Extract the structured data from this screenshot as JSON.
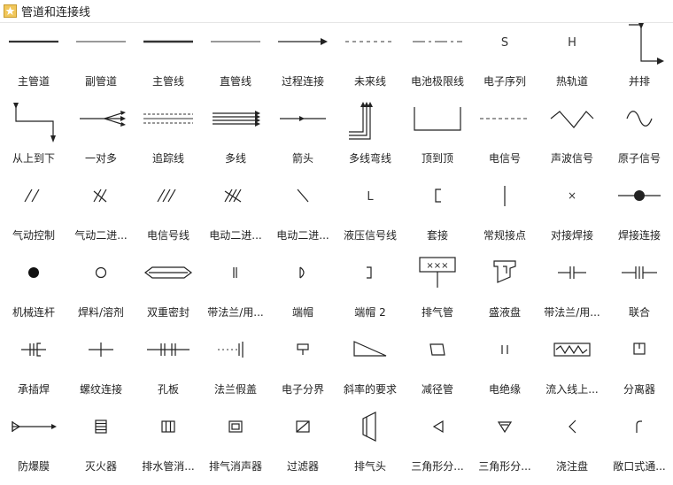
{
  "header": {
    "title": "管道和连接线"
  },
  "rows": [
    [
      {
        "id": "main-pipe",
        "label": "主管道"
      },
      {
        "id": "secondary-pipe",
        "label": "副管道"
      },
      {
        "id": "main-line",
        "label": "主管线"
      },
      {
        "id": "straight-line",
        "label": "直管线"
      },
      {
        "id": "process-connection",
        "label": "过程连接"
      },
      {
        "id": "future-line",
        "label": "未来线"
      },
      {
        "id": "battery-limit-line",
        "label": "电池极限线"
      },
      {
        "id": "electronic-sequence",
        "label": "电子序列",
        "glyph": "S"
      },
      {
        "id": "hot-rail",
        "label": "热轨道",
        "glyph": "H"
      },
      {
        "id": "parallel-arrange",
        "label": "并排"
      }
    ],
    [
      {
        "id": "top-to-bottom",
        "label": "从上到下"
      },
      {
        "id": "one-to-many",
        "label": "一对多"
      },
      {
        "id": "tracing-line",
        "label": "追踪线"
      },
      {
        "id": "multi-line",
        "label": "多线"
      },
      {
        "id": "arrow",
        "label": "箭头"
      },
      {
        "id": "multi-line-bend",
        "label": "多线弯线"
      },
      {
        "id": "top-to-top",
        "label": "顶到顶"
      },
      {
        "id": "electric-signal",
        "label": "电信号"
      },
      {
        "id": "sonic-signal",
        "label": "声波信号"
      },
      {
        "id": "atomic-signal",
        "label": "原子信号"
      }
    ],
    [
      {
        "id": "pneumatic-control",
        "label": "气动控制"
      },
      {
        "id": "pneumatic-binary-1",
        "label": "气动二进..."
      },
      {
        "id": "electric-signal-line",
        "label": "电信号线"
      },
      {
        "id": "electric-binary",
        "label": "电动二进..."
      },
      {
        "id": "electric-binary-2",
        "label": "电动二进..."
      },
      {
        "id": "hydraulic-signal-line",
        "label": "液压信号线",
        "glyph": "L"
      },
      {
        "id": "socket-joint",
        "label": "套接"
      },
      {
        "id": "regular-contact",
        "label": "常规接点"
      },
      {
        "id": "butt-weld",
        "label": "对接焊接",
        "glyph": "×"
      },
      {
        "id": "weld-connection",
        "label": "焊接连接"
      }
    ],
    [
      {
        "id": "mechanical-linkage",
        "label": "机械连杆"
      },
      {
        "id": "solder-solvent",
        "label": "焊料/溶剂"
      },
      {
        "id": "double-seal",
        "label": "双重密封"
      },
      {
        "id": "flanged-1",
        "label": "带法兰/用..."
      },
      {
        "id": "end-cap",
        "label": "端帽"
      },
      {
        "id": "end-cap-2",
        "label": "端帽 2"
      },
      {
        "id": "exhaust-pipe",
        "label": "排气管"
      },
      {
        "id": "drip-pan",
        "label": "盛液盘"
      },
      {
        "id": "flanged-2",
        "label": "带法兰/用..."
      },
      {
        "id": "union",
        "label": "联合"
      }
    ],
    [
      {
        "id": "socket-weld",
        "label": "承插焊"
      },
      {
        "id": "threaded-connection",
        "label": "螺纹连接"
      },
      {
        "id": "orifice-plate",
        "label": "孔板"
      },
      {
        "id": "flange-blind",
        "label": "法兰假盖"
      },
      {
        "id": "electronic-boundary",
        "label": "电子分界"
      },
      {
        "id": "slope-requirement",
        "label": "斜率的要求"
      },
      {
        "id": "reducer",
        "label": "减径管"
      },
      {
        "id": "electric-insulation",
        "label": "电绝缘"
      },
      {
        "id": "inflow-line",
        "label": "流入线上..."
      },
      {
        "id": "separator",
        "label": "分离器"
      }
    ],
    [
      {
        "id": "rupture-disk",
        "label": "防爆膜"
      },
      {
        "id": "flame-arrester",
        "label": "灭火器"
      },
      {
        "id": "drain-silencer",
        "label": "排水管消..."
      },
      {
        "id": "exhaust-silencer",
        "label": "排气消声器"
      },
      {
        "id": "filter",
        "label": "过滤器"
      },
      {
        "id": "exhaust-head",
        "label": "排气头"
      },
      {
        "id": "triangle-split-1",
        "label": "三角形分..."
      },
      {
        "id": "triangle-split-2",
        "label": "三角形分..."
      },
      {
        "id": "pouring-pipe",
        "label": "浇注盘"
      },
      {
        "id": "open-vent",
        "label": "敞口式通..."
      }
    ]
  ]
}
